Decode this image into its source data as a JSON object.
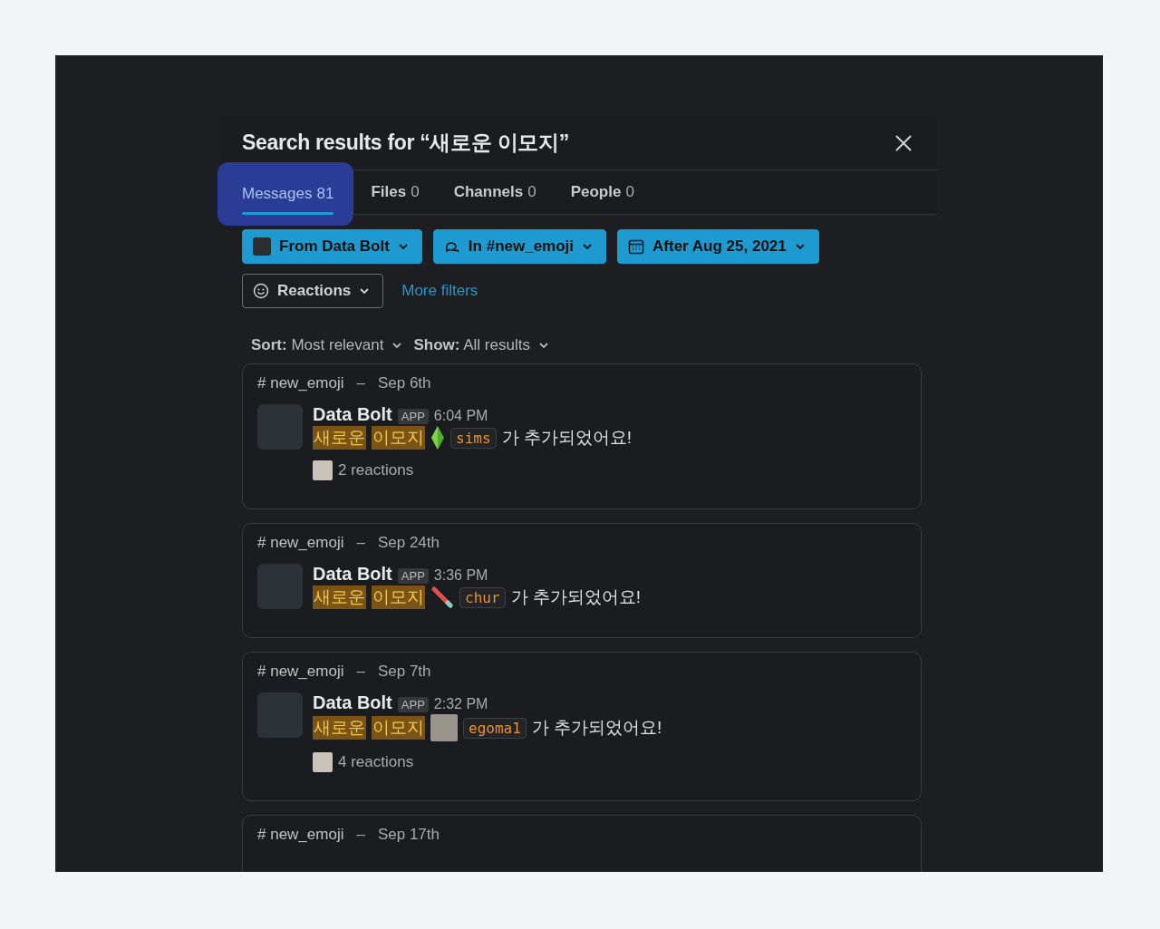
{
  "title": "Search results for “새로운 이모지”",
  "tabs": [
    {
      "label": "Messages",
      "count": "81",
      "selected": true
    },
    {
      "label": "Files",
      "count": "0",
      "selected": false
    },
    {
      "label": "Channels",
      "count": "0",
      "selected": false
    },
    {
      "label": "People",
      "count": "0",
      "selected": false
    }
  ],
  "filters": [
    {
      "kind": "avatar",
      "label": "From Data Bolt",
      "applied": true
    },
    {
      "kind": "channel",
      "label": "In #new_emoji",
      "applied": true
    },
    {
      "kind": "calendar",
      "label": "After Aug 25, 2021",
      "applied": true
    },
    {
      "kind": "smiley",
      "label": "Reactions",
      "applied": false
    }
  ],
  "more_filters": "More filters",
  "sort": {
    "label": "Sort:",
    "value": "Most relevant"
  },
  "show": {
    "label": "Show:",
    "value": "All results"
  },
  "results": [
    {
      "channel": "# new_emoji",
      "separator": "–",
      "date": "Sep 6th",
      "sender": "Data Bolt",
      "badge": "APP",
      "time": "6:04 PM",
      "highlights": [
        "새로운",
        "이모지"
      ],
      "kind": "gem",
      "code": "sims",
      "suffix": "가 추가되었어요!",
      "reactions": "2 reactions"
    },
    {
      "channel": "# new_emoji",
      "separator": "–",
      "date": "Sep 24th",
      "sender": "Data Bolt",
      "badge": "APP",
      "time": "3:36 PM",
      "highlights": [
        "새로운",
        "이모지"
      ],
      "kind": "stick",
      "code": "chur",
      "suffix": "가 추가되었어요!"
    },
    {
      "channel": "# new_emoji",
      "separator": "–",
      "date": "Sep 7th",
      "sender": "Data Bolt",
      "badge": "APP",
      "time": "2:32 PM",
      "highlights": [
        "새로운",
        "이모지"
      ],
      "kind": "photo",
      "code": "egoma1",
      "suffix": "가 추가되었어요!",
      "reactions": "4 reactions"
    },
    {
      "channel": "# new_emoji",
      "separator": "–",
      "date": "Sep 17th"
    }
  ]
}
